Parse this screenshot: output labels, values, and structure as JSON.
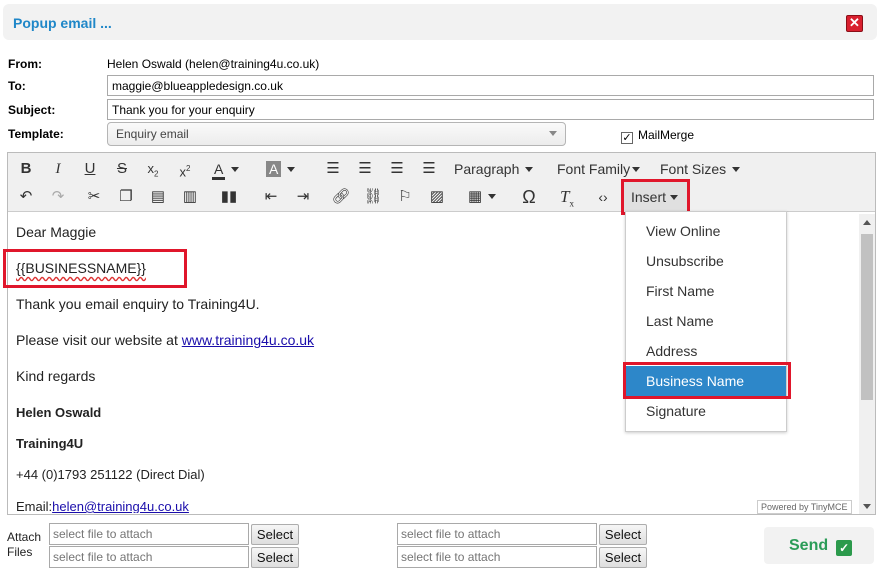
{
  "window": {
    "title": "Popup email ...",
    "close_icon": "close-icon"
  },
  "form": {
    "from_label": "From:",
    "from_value": "Helen Oswald (helen@training4u.co.uk)",
    "to_label": "To:",
    "to_value": "maggie@blueappledesign.co.uk",
    "subject_label": "Subject:",
    "subject_value": "Thank you for your enquiry",
    "template_label": "Template:",
    "template_value": "Enquiry email",
    "mailmerge_label": "MailMerge",
    "mailmerge_checked": true
  },
  "toolbar": {
    "paragraph": "Paragraph",
    "font_family": "Font Family",
    "font_sizes": "Font Sizes",
    "insert": "Insert",
    "icons_row1": [
      "bold-icon",
      "italic-icon",
      "underline-icon",
      "strikethrough-icon",
      "subscript-icon",
      "superscript-icon",
      "text-color-icon",
      "background-color-icon",
      "align-left-icon",
      "align-center-icon",
      "align-right-icon",
      "align-justify-icon"
    ],
    "icons_row2": [
      "undo-icon",
      "redo-icon",
      "cut-icon",
      "copy-icon",
      "paste-icon",
      "paste-text-icon",
      "find-replace-icon",
      "outdent-icon",
      "indent-icon",
      "link-icon",
      "unlink-icon",
      "anchor-icon",
      "image-icon",
      "table-icon",
      "special-char-icon",
      "clear-format-icon",
      "code-icon"
    ]
  },
  "content": {
    "greeting": "Dear Maggie",
    "merge_field": "{{BUSINESSNAME}}",
    "line1": "Thank you email enquiry to Training4U.",
    "line2_prefix": "Please visit our website at ",
    "line2_link": "www.training4u.co.uk",
    "closing": "Kind regards",
    "sig_name": "Helen Oswald",
    "sig_company": "Training4U",
    "sig_phone": "+44 (0)1793 251122 (Direct Dial)",
    "sig_email_prefix": "Email:",
    "sig_email": "helen@training4u.co.uk",
    "powered_by": "Powered by TinyMCE"
  },
  "insert_menu": {
    "items": [
      "View Online",
      "Unsubscribe",
      "First Name",
      "Last Name",
      "Address",
      "Business Name",
      "Signature"
    ],
    "selected": "Business Name"
  },
  "attach": {
    "label_line1": "Attach",
    "label_line2": "Files",
    "placeholder": "select file to attach",
    "select_label": "Select"
  },
  "send": {
    "label": "Send"
  },
  "colors": {
    "accent": "#1f87c8",
    "highlight": "#e0162b",
    "menu_active": "#2d87c9",
    "send": "#2a9c57"
  }
}
